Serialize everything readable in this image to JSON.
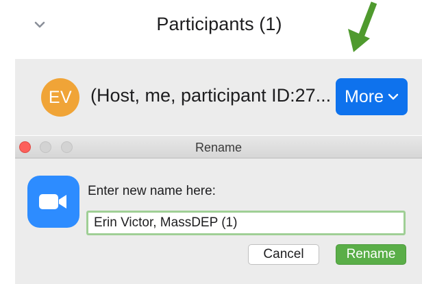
{
  "header": {
    "title": "Participants (1)",
    "collapse_icon": "chevron-down-icon"
  },
  "participant": {
    "initials": "EV",
    "name": "(Host, me, participant ID:27...",
    "more_label": "More",
    "avatar_color": "#f0a437"
  },
  "dialog": {
    "title": "Rename",
    "prompt": "Enter new name here:",
    "input_value": "Erin Victor, MassDEP (1)",
    "cancel_label": "Cancel",
    "rename_label": "Rename",
    "app_icon": "zoom-camera-icon"
  },
  "colors": {
    "more_button": "#0e72ed",
    "rename_button": "#5aae48",
    "annotation_arrow": "#4f9a2e",
    "input_focus_border": "#9fcf95"
  }
}
